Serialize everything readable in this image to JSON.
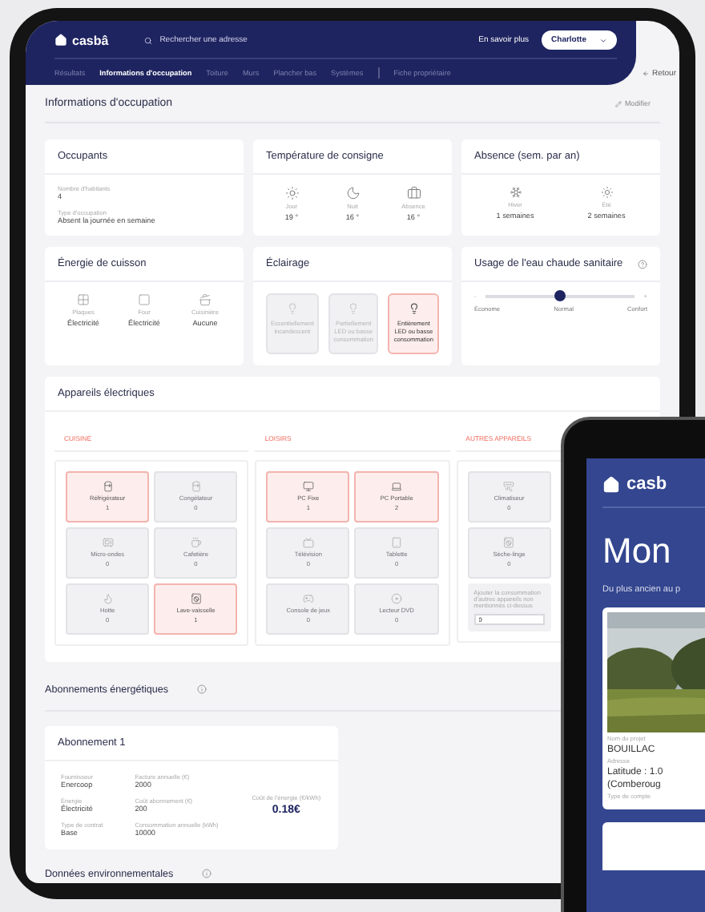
{
  "header": {
    "logo": "casbâ",
    "search": {
      "placeholder": "Rechercher une adresse"
    },
    "learn_more": "En savoir plus",
    "user": "Charlotte",
    "back": "Retour"
  },
  "nav_tabs": [
    {
      "label": "Résultats",
      "selected": false
    },
    {
      "label": "Informations d'occupation",
      "selected": true
    },
    {
      "label": "Toiture",
      "selected": false
    },
    {
      "label": "Murs",
      "selected": false
    },
    {
      "label": "Plancher bas",
      "selected": false
    },
    {
      "label": "Systèmes",
      "selected": false
    },
    {
      "label": "Fiche propriétaire",
      "selected": false
    }
  ],
  "page": {
    "title": "Informations d'occupation",
    "edit": "Modifier"
  },
  "occupants": {
    "title": "Occupants",
    "fields": [
      {
        "label": "Nombre d'habitants",
        "value": "4"
      },
      {
        "label": "Type d'occupation",
        "value": "Absent la journée en semaine"
      }
    ]
  },
  "temperature": {
    "title": "Température de consigne",
    "items": [
      {
        "label": "Jour",
        "value": "19 °"
      },
      {
        "label": "Nuit",
        "value": "16 °"
      },
      {
        "label": "Absence",
        "value": "16 °"
      }
    ]
  },
  "absence": {
    "title": "Absence (sem. par an)",
    "items": [
      {
        "label": "Hiver",
        "value": "1 semaines"
      },
      {
        "label": "Été",
        "value": "2 semaines"
      }
    ]
  },
  "cooking": {
    "title": "Énergie de cuisson",
    "items": [
      {
        "label": "Plaques",
        "value": "Électricité"
      },
      {
        "label": "Four",
        "value": "Électricité"
      },
      {
        "label": "Cuisinière",
        "value": "Aucune"
      }
    ]
  },
  "lighting": {
    "title": "Éclairage",
    "options": [
      {
        "label": "Essentiellement incandescent",
        "selected": false
      },
      {
        "label": "Partiellement LED ou basse consommation",
        "selected": false
      },
      {
        "label": "Entièrement LED ou basse consommation",
        "selected": true
      }
    ]
  },
  "hot_water": {
    "title": "Usage de l'eau chaude sanitaire",
    "minus": "-",
    "plus": "+",
    "level": 0.5,
    "labels": [
      "Économe",
      "Normal",
      "Confort"
    ]
  },
  "appliances": {
    "title": "Appareils électriques",
    "groups": [
      {
        "title": "CUISINE",
        "items": [
          {
            "name": "Réfrigérateur",
            "count": "1",
            "selected": true
          },
          {
            "name": "Congélateur",
            "count": "0",
            "selected": false
          },
          {
            "name": "Micro-ondes",
            "count": "0",
            "selected": false
          },
          {
            "name": "Cafetière",
            "count": "0",
            "selected": false
          },
          {
            "name": "Hotte",
            "count": "0",
            "selected": false
          },
          {
            "name": "Lave-vaisselle",
            "count": "1",
            "selected": true
          }
        ]
      },
      {
        "title": "LOISIRS",
        "items": [
          {
            "name": "PC Fixe",
            "count": "1",
            "selected": true
          },
          {
            "name": "PC Portable",
            "count": "2",
            "selected": true
          },
          {
            "name": "Télévision",
            "count": "0",
            "selected": false
          },
          {
            "name": "Tablette",
            "count": "0",
            "selected": false
          },
          {
            "name": "Console de jeux",
            "count": "0",
            "selected": false
          },
          {
            "name": "Lecteur DVD",
            "count": "0",
            "selected": false
          }
        ]
      },
      {
        "title": "AUTRES APPAREILS",
        "items": [
          {
            "name": "Climatiseur",
            "count": "0",
            "selected": false
          },
          {
            "name": "Sèche-linge",
            "count": "0",
            "selected": false
          }
        ],
        "other": {
          "label": "Ajouter la consommation d'autres appareils non mentionnés ci-dessus",
          "value": "0"
        }
      }
    ]
  },
  "subscriptions": {
    "title": "Abonnements énergétiques",
    "card": {
      "title": "Abonnement 1",
      "columns": [
        [
          {
            "label": "Fournisseur",
            "value": "Enercoop"
          },
          {
            "label": "Énergie",
            "value": "Électricité"
          },
          {
            "label": "Type de contrat",
            "value": "Base"
          }
        ],
        [
          {
            "label": "Facture annuelle (€)",
            "value": "2000"
          },
          {
            "label": "Coût abonnement (€)",
            "value": "200"
          },
          {
            "label": "Consommation annuelle (kWh)",
            "value": "10000"
          }
        ]
      ],
      "highlight": {
        "label": "Coût de l'énergie (€/kWh)",
        "value": "0.18€"
      }
    }
  },
  "environment": {
    "title": "Données environnementales"
  },
  "phone": {
    "logo": "casb",
    "heading": "Mon",
    "subtitle": "Du plus ancien au p",
    "card": {
      "fields": [
        {
          "label": "Nom du projet",
          "value": "BOUILLAC"
        },
        {
          "label": "Adresse",
          "value": "Latitude : 1.0"
        },
        {
          "value": "(Comberoug"
        },
        {
          "label": "Type de compte"
        }
      ]
    }
  }
}
